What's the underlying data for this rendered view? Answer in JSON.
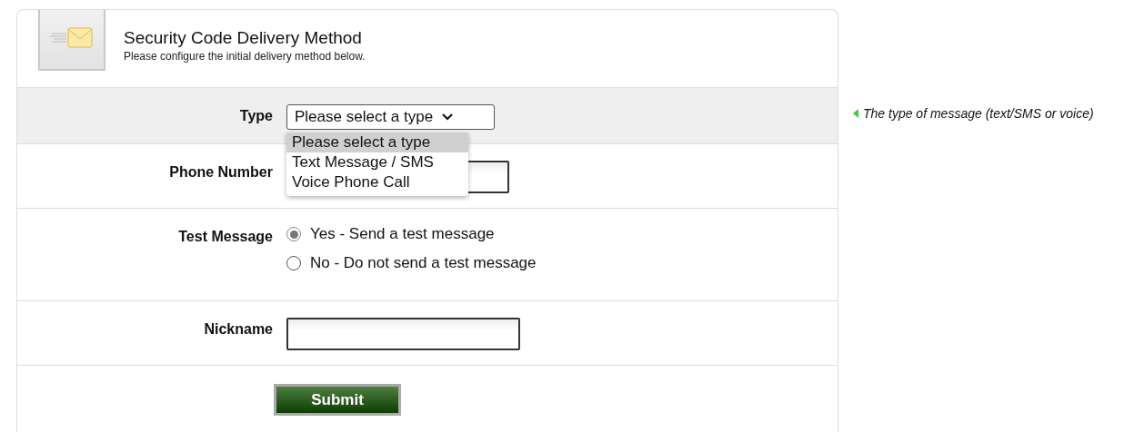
{
  "header": {
    "title": "Security Code Delivery Method",
    "subtitle": "Please configure the initial delivery method below."
  },
  "fields": [
    {
      "kind": "select",
      "label": "Type",
      "value": "Please select a type",
      "expanded": true,
      "highlighted": true,
      "hint": "The type of message (text/SMS or voice)",
      "options": [
        {
          "label": "Please select a type",
          "selected": true
        },
        {
          "label": "Text Message / SMS",
          "selected": false
        },
        {
          "label": "Voice Phone Call",
          "selected": false
        }
      ]
    },
    {
      "kind": "text",
      "label": "Phone Number",
      "highlighted": false
    },
    {
      "kind": "radio",
      "label": "Test Message",
      "highlighted": false,
      "options": [
        {
          "label": "Yes - Send a test message",
          "selected": true
        },
        {
          "label": "No - Do not send a test message",
          "selected": false
        }
      ]
    },
    {
      "kind": "text",
      "label": "Nickname",
      "highlighted": false
    }
  ],
  "submit": {
    "label": "Submit"
  }
}
